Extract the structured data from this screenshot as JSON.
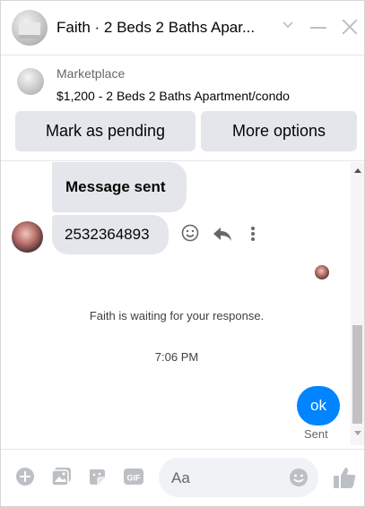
{
  "header": {
    "title": "Faith · 2 Beds 2 Baths Apar...",
    "chevron_icon": "chevron-down-icon",
    "minimize_icon": "minimize-icon",
    "close_icon": "close-icon"
  },
  "listing": {
    "source": "Marketplace",
    "detail": "$1,200 - 2 Beds 2 Baths Apartment/condo"
  },
  "buttons": {
    "mark_pending": "Mark as pending",
    "more_options": "More options"
  },
  "messages": {
    "incoming": [
      {
        "text": "Message sent"
      },
      {
        "text": "2532364893"
      }
    ],
    "waiting_notice": "Faith is waiting for your response.",
    "timestamp": "7:06 PM",
    "outgoing": [
      {
        "text": "ok",
        "status": "Sent"
      }
    ]
  },
  "composer": {
    "placeholder": "Aa",
    "icons": [
      "plus-icon",
      "photo-icon",
      "sticker-icon",
      "gif-icon",
      "emoji-icon",
      "thumbs-up-icon"
    ]
  },
  "colors": {
    "accent": "#0084ff",
    "icon": "#bcc0c4",
    "bubble_in": "#e4e6eb"
  }
}
